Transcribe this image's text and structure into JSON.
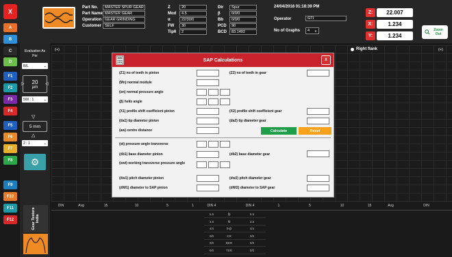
{
  "header": {
    "close_label": "X",
    "fields_col1": [
      {
        "label": "Part No.",
        "value": "MASTER SPUR GEAR"
      },
      {
        "label": "Part Name",
        "value": "MASTER GEAR"
      },
      {
        "label": "Operation",
        "value": "GEAR GRINDING"
      },
      {
        "label": "Customer",
        "value": "SELF"
      }
    ],
    "fields_col2": [
      {
        "label": "Z",
        "value": "20"
      },
      {
        "label": "Mod",
        "value": "4.5"
      },
      {
        "label": "α",
        "value": "22/30/0"
      },
      {
        "label": "FW",
        "value": "30"
      },
      {
        "label": "Tipθ",
        "value": "2"
      }
    ],
    "fields_col3": [
      {
        "label": "Dir",
        "value": "Spur"
      },
      {
        "label": "β",
        "value": "0/0/0"
      },
      {
        "label": "Bb",
        "value": "0/0/0"
      },
      {
        "label": "PCD",
        "value": "90"
      },
      {
        "label": "BCD",
        "value": "83.1492"
      }
    ],
    "datetime": "24/04/2018 01:18:39 PM",
    "operator_label": "Operator",
    "operator_value": "GTI",
    "graphs_label": "No of Graphs",
    "graphs_value": "4",
    "readouts": [
      {
        "label": "Z:",
        "value": "22.007"
      },
      {
        "label": "X:",
        "value": "1.234"
      },
      {
        "label": "Y:",
        "value": "1.234"
      }
    ],
    "zoom_label": "Zoom Out"
  },
  "side_buttons": [
    {
      "label": "A",
      "color": "#e8702a"
    },
    {
      "label": "B",
      "color": "#2f8fd8"
    },
    {
      "label": "C",
      "color": "#2a2a2a"
    },
    {
      "label": "D",
      "color": "#6cbf4a"
    },
    {
      "label": "F1",
      "color": "#1e5fbf"
    },
    {
      "label": "F2",
      "color": "#1b9aa8"
    },
    {
      "label": "F3",
      "color": "#7a2aa8"
    },
    {
      "label": "F4",
      "color": "#d82828"
    },
    {
      "label": "F5",
      "color": "#1e5fbf"
    },
    {
      "label": "F6",
      "color": "#e88a2a"
    },
    {
      "label": "F7",
      "color": "#e8b02a"
    },
    {
      "label": "F8",
      "color": "#2aa84a"
    },
    {
      "label": "F9",
      "color": "#1e7fbf"
    },
    {
      "label": "F10",
      "color": "#e87a2a"
    },
    {
      "label": "F11",
      "color": "#1b9aa8"
    },
    {
      "label": "F12",
      "color": "#d82828"
    }
  ],
  "left_panel": {
    "eval_label": "Evaluation As Per",
    "eval_value": "R/L",
    "micron_value": "20",
    "micron_unit": "µm",
    "ratio_value": "500 : 1",
    "mm_value": "5 mm",
    "scale_value": "2 : 1",
    "brand_text": "Gear Testers India"
  },
  "graph": {
    "left_marker": "(+)",
    "right_marker": "(+)",
    "right_flank": "Right flank"
  },
  "table": {
    "headers": [
      "DIN",
      "Avg",
      "15",
      "10",
      "5",
      "1",
      "DIN 4",
      "",
      "DIN 4",
      "1",
      "5",
      "10",
      "15",
      "Avg",
      "DIN"
    ],
    "rows": [
      [
        "5.5",
        "fβ",
        "5.5"
      ],
      [
        "3.5",
        "fθ",
        "3.5"
      ],
      [
        "4/4",
        "fHβ",
        "4/4"
      ],
      [
        "0/0",
        "CR",
        "0/0"
      ],
      [
        "0/0",
        "BER",
        "0/0"
      ],
      [
        "0/0",
        "TER",
        "0/0"
      ]
    ]
  },
  "modal": {
    "title": "SAP Calculations",
    "close": "X",
    "z1": "(Z1) no of teeth in pinion",
    "z2": "(Z2) no of teeth in gear",
    "mn": "(Mn) normal module",
    "an": "(αn) normal pressure angle",
    "beta": "(β) helix angle",
    "x1": "(X1) profile shift coefficient pinion",
    "x2": "(X2) profile shift coefficient gear",
    "da1": "(da1) tip diameter pinion",
    "da2": "(da2) tip diameter gear",
    "aw": "(aw) centre distance",
    "calc": "Calculate",
    "reset": "Reset",
    "at": "(αt) pressure angle transverse",
    "db1": "(db1) base diameter pinion",
    "db2": "(db2) base diameter gear",
    "awt": "(αwt) working transverse pressure angle",
    "dw1": "(dw1) pitch diameter pinion",
    "dw2": "(dw2) pitch diameter gear",
    "dnf1": "(dNf1) diameter to SAP pinion",
    "dnf2": "(dNf2) diameter to SAP gear"
  }
}
